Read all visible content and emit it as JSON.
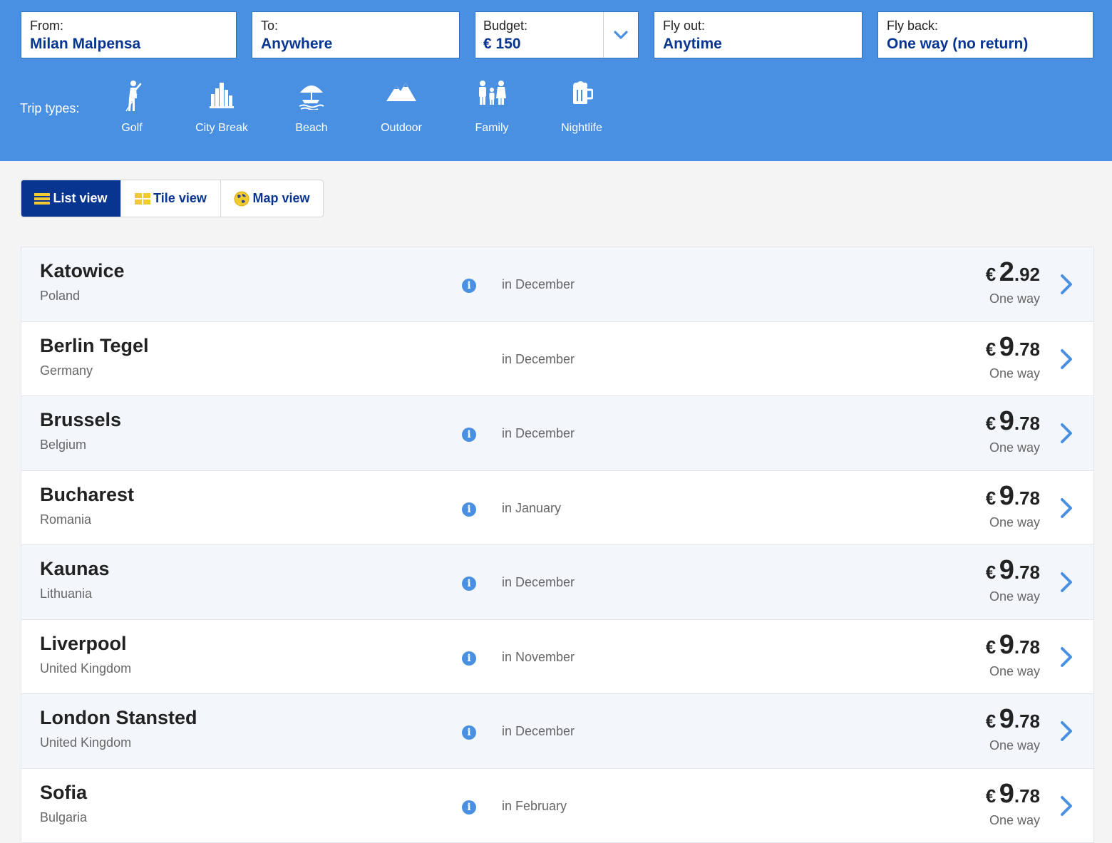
{
  "search": {
    "from": {
      "label": "From:",
      "value": "Milan Malpensa"
    },
    "to": {
      "label": "To:",
      "value": "Anywhere"
    },
    "budget": {
      "label": "Budget:",
      "value": "€ 150"
    },
    "fly_out": {
      "label": "Fly out:",
      "value": "Anytime"
    },
    "fly_back": {
      "label": "Fly back:",
      "value": "One way (no return)"
    }
  },
  "trip_types": {
    "label": "Trip types:",
    "items": [
      {
        "label": "Golf",
        "icon": "golfer-icon"
      },
      {
        "label": "City Break",
        "icon": "city-skyline-icon"
      },
      {
        "label": "Beach",
        "icon": "beach-umbrella-icon"
      },
      {
        "label": "Outdoor",
        "icon": "mountains-icon"
      },
      {
        "label": "Family",
        "icon": "family-icon"
      },
      {
        "label": "Nightlife",
        "icon": "beer-mug-icon"
      }
    ]
  },
  "views": {
    "list": "List view",
    "tile": "Tile view",
    "map": "Map view",
    "active": "list"
  },
  "results": [
    {
      "city": "Katowice",
      "country": "Poland",
      "info": true,
      "month": "in December",
      "currency": "€",
      "price_int": "2",
      "price_dec": ".92",
      "type": "One way"
    },
    {
      "city": "Berlin Tegel",
      "country": "Germany",
      "info": false,
      "month": "in December",
      "currency": "€",
      "price_int": "9",
      "price_dec": ".78",
      "type": "One way"
    },
    {
      "city": "Brussels",
      "country": "Belgium",
      "info": true,
      "month": "in December",
      "currency": "€",
      "price_int": "9",
      "price_dec": ".78",
      "type": "One way"
    },
    {
      "city": "Bucharest",
      "country": "Romania",
      "info": true,
      "month": "in January",
      "currency": "€",
      "price_int": "9",
      "price_dec": ".78",
      "type": "One way"
    },
    {
      "city": "Kaunas",
      "country": "Lithuania",
      "info": true,
      "month": "in December",
      "currency": "€",
      "price_int": "9",
      "price_dec": ".78",
      "type": "One way"
    },
    {
      "city": "Liverpool",
      "country": "United Kingdom",
      "info": true,
      "month": "in November",
      "currency": "€",
      "price_int": "9",
      "price_dec": ".78",
      "type": "One way"
    },
    {
      "city": "London Stansted",
      "country": "United Kingdom",
      "info": true,
      "month": "in December",
      "currency": "€",
      "price_int": "9",
      "price_dec": ".78",
      "type": "One way"
    },
    {
      "city": "Sofia",
      "country": "Bulgaria",
      "info": true,
      "month": "in February",
      "currency": "€",
      "price_int": "9",
      "price_dec": ".78",
      "type": "One way"
    }
  ],
  "colors": {
    "header_bg": "#4a90e2",
    "brand_navy": "#073590",
    "accent_blue": "#4a90e2",
    "view_icon_yellow": "#f1c933"
  }
}
